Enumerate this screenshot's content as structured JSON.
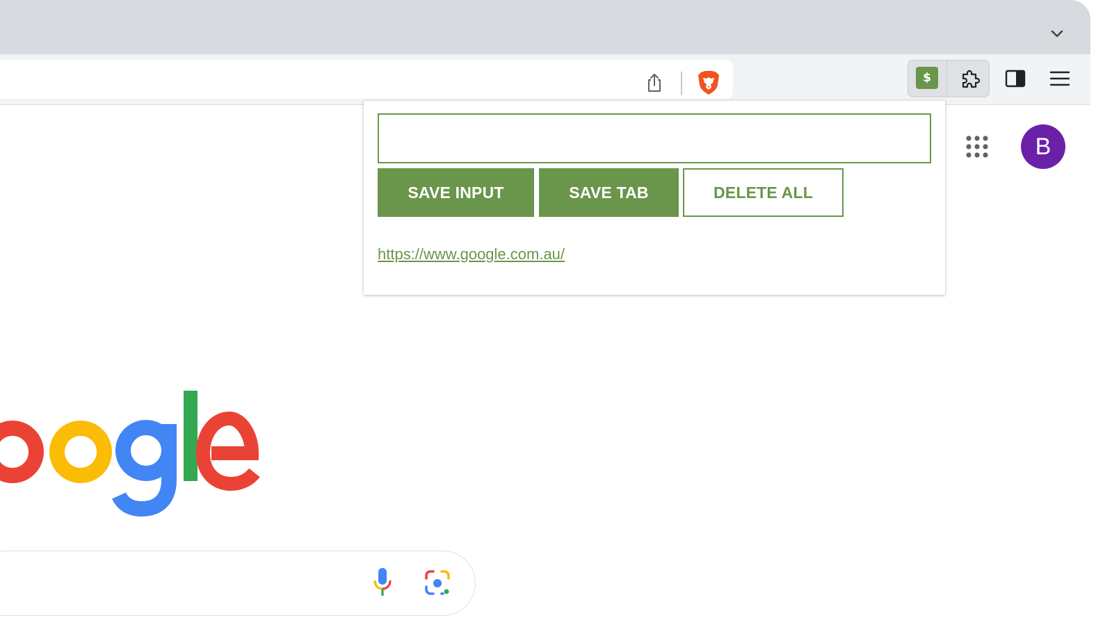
{
  "browser": {
    "profile_initial": "B"
  },
  "extension": {
    "icon_glyph": "$",
    "input_value": "",
    "buttons": {
      "save_input": "SAVE INPUT",
      "save_tab": "SAVE TAB",
      "delete_all": "DELETE ALL"
    },
    "saved_leads": [
      "https://www.google.com.au/"
    ]
  },
  "google": {
    "logo_text": "oogle"
  },
  "colors": {
    "accent": "#69964b",
    "avatar": "#6a21a8",
    "google_blue": "#4285f4",
    "google_red": "#ea4335",
    "google_yellow": "#fbbc05",
    "google_green": "#34a853"
  },
  "icons": {
    "tab_dropdown": "chevron-down-icon",
    "share": "share-icon",
    "brave": "brave-lion-icon",
    "extensions": "puzzle-icon",
    "side_panel": "side-panel-icon",
    "menu": "hamburger-menu-icon",
    "apps": "apps-grid-icon",
    "voice": "microphone-icon",
    "lens": "camera-lens-icon"
  }
}
